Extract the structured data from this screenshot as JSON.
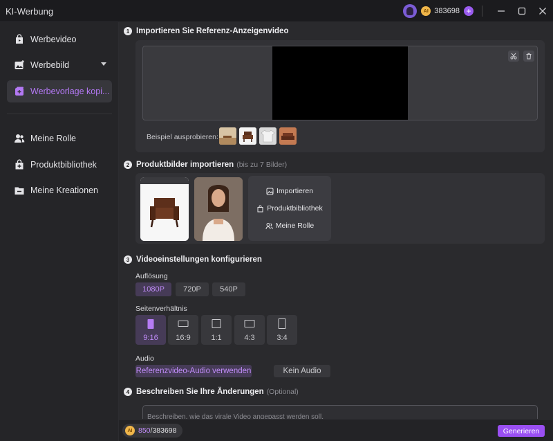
{
  "window": {
    "title": "KI-Werbung",
    "credits": "383698",
    "coin_symbol": "AI"
  },
  "sidebar": {
    "items": [
      {
        "label": "Werbevideo"
      },
      {
        "label": "Werbebild"
      },
      {
        "label": "Werbevorlage kopi..."
      },
      {
        "label": "Meine Rolle"
      },
      {
        "label": "Produktbibliothek"
      },
      {
        "label": "Meine Kreationen"
      }
    ],
    "active_index": 2
  },
  "step1": {
    "num": "1",
    "title": "Importieren Sie Referenz-Anzeigenvideo",
    "example_label": "Beispiel ausprobieren:"
  },
  "step2": {
    "num": "2",
    "title": "Produktbilder importieren",
    "hint": "(bis zu 7 Bilder)",
    "actions": {
      "import": "Importieren",
      "library": "Produktbibliothek",
      "role": "Meine Rolle"
    }
  },
  "step3": {
    "num": "3",
    "title": "Videoeinstellungen konfigurieren",
    "resolution_label": "Auflösung",
    "resolutions": [
      "1080P",
      "720P",
      "540P"
    ],
    "resolution_selected": "1080P",
    "aspect_label": "Seitenverhältnis",
    "aspects": [
      "9:16",
      "16:9",
      "1:1",
      "4:3",
      "3:4"
    ],
    "aspect_selected": "9:16",
    "audio_label": "Audio",
    "audio_options": [
      "Referenzvideo-Audio verwenden",
      "Kein Audio"
    ],
    "audio_selected": "Referenzvideo-Audio verwenden"
  },
  "step4": {
    "num": "4",
    "title": "Beschreiben Sie Ihre Änderungen",
    "hint": "(Optional)",
    "placeholder": "Beschreiben, wie das virale Video angepasst werden soll.",
    "value": ""
  },
  "footer": {
    "cost_used": "850",
    "cost_total": "/383698",
    "generate_label": "Generieren"
  },
  "colors": {
    "accent": "#9a4ff2",
    "accent_text": "#c08cf8",
    "background": "#2a2a2d"
  }
}
